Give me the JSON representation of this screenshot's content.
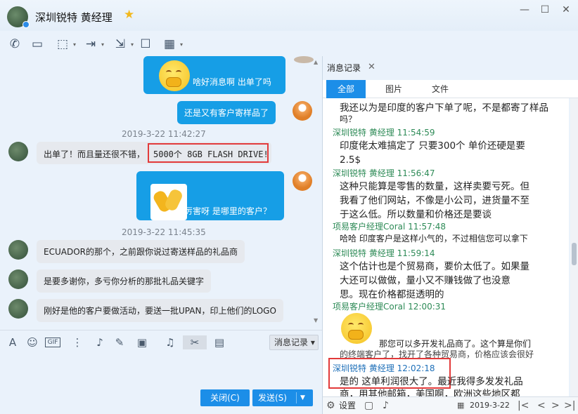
{
  "window": {
    "title": "深圳锐特 黄经理",
    "star": "★",
    "minimize": "—",
    "maximize": "☐",
    "close": "✕"
  },
  "toolbar": {
    "phone": "✆",
    "video": "▭",
    "screen": "⬚",
    "transfer": "⇥",
    "remote": "⇲",
    "comment": "☐",
    "apps": "▦"
  },
  "chat": {
    "messages": [
      {
        "from": "me",
        "kind": "emoji",
        "text": "啥好消息啊 出单了吗"
      },
      {
        "from": "me",
        "kind": "text",
        "text": "还是又有客户寄样品了"
      },
      {
        "kind": "time",
        "text": "2019-3-22 11:42:27"
      },
      {
        "from": "them",
        "kind": "text",
        "text": "出单了！而且量还很不错，",
        "highlight": "5000个 8GB FLASH DRIVE!"
      },
      {
        "from": "me",
        "kind": "emoji",
        "text": "厉害呀 是哪里的客户？"
      },
      {
        "kind": "time",
        "text": "2019-3-22 11:45:35"
      },
      {
        "from": "them",
        "kind": "text",
        "text": "ECUADOR的那个，之前跟你说过寄送样品的礼品商"
      },
      {
        "from": "them",
        "kind": "text",
        "text": "是要多谢你，多亏你分析的那批礼品关键字"
      },
      {
        "from": "them",
        "kind": "text",
        "text": "刚好是他的客户要做活动，要送一批UPAN，印上他们的LOGO"
      }
    ]
  },
  "input": {
    "record_button": "消息记录 ▾",
    "close_button": "关闭(C)",
    "send_button": "发送(S)",
    "send_arrow": "▼"
  },
  "history": {
    "tab": "消息记录",
    "tab_close": "✕",
    "filters": [
      "全部",
      "图片",
      "文件"
    ],
    "items": [
      {
        "sender": "",
        "date": "",
        "lines": [
          "我还以为是印度的客户下单了呢，不是都寄了样品",
          "吗？"
        ]
      },
      {
        "sender": "深圳锐特 黄经理",
        "date": "11:54:59",
        "lines": [
          "印度佬太难搞定了 只要300个 单价还硬是要",
          "2.5$"
        ]
      },
      {
        "sender": "深圳锐特 黄经理",
        "date": "11:56:47",
        "lines": [
          "这种只能算是零售的数量，这样卖要亏死。但",
          "我看了他们网站，不像是小公司，进货量不至",
          "于这么低。所以数量和价格还是要谈"
        ]
      },
      {
        "sender": "项易客户经理Coral",
        "date": "11:57:48",
        "lines": [
          "哈哈 印度客户是这样小气的，不过相信您可以拿下"
        ]
      },
      {
        "sender": "深圳锐特 黄经理",
        "date": "11:59:14",
        "lines": [
          "这个估计也是个贸易商，要价太低了。如果量",
          "大还可以做做，量小又不赚钱做了也没意",
          "思。现在价格都挺透明的"
        ]
      },
      {
        "sender": "项易客户经理Coral",
        "date": "12:00:31",
        "lines": [
          "那您可以多开发礼品商了。这个算是你们",
          "的终端客户了，找开了各种贸易商，价格应该会很好"
        ]
      },
      {
        "sender": "深圳锐特 黄经理",
        "date": "12:02:18",
        "lines": [
          "是的 这单利润很大了。最近我得多发发礼品",
          "商，用其他邮箱，美国啊，欧洲这些地区都"
        ]
      }
    ],
    "footer": {
      "settings": "设置",
      "date": "2019-3-22",
      "first": "|<",
      "prev": "<",
      "next": ">",
      "last": ">|"
    }
  }
}
